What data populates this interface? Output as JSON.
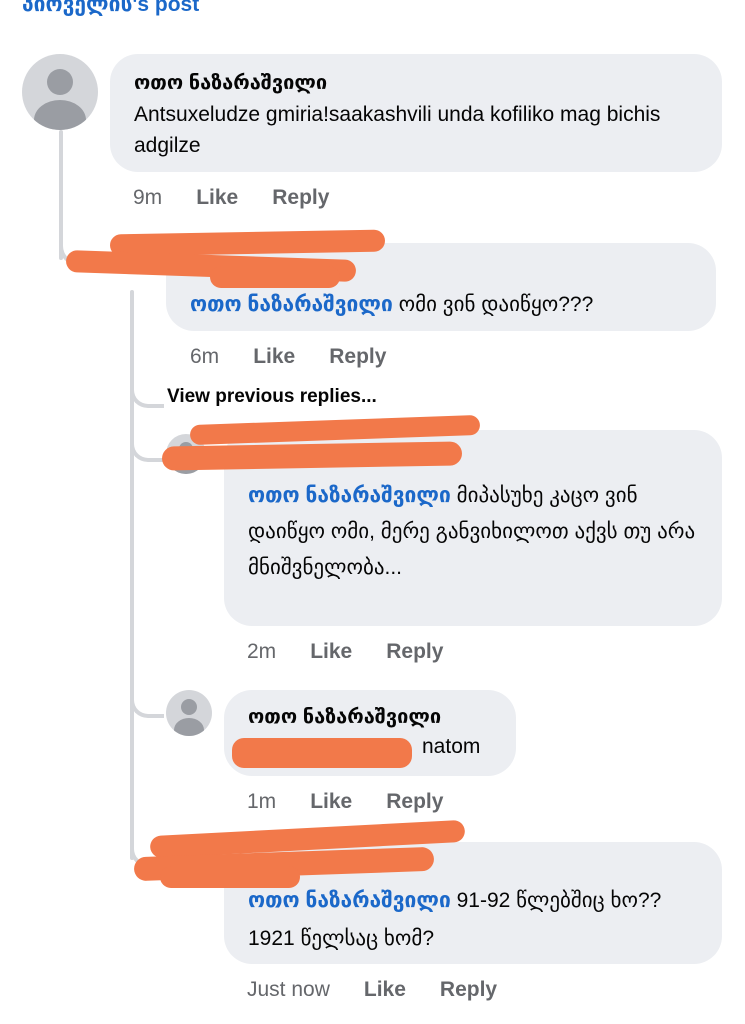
{
  "header": {
    "name_text": " პიოველის",
    "suffix": "'s post"
  },
  "comments": [
    {
      "author": "ოთო ნაზარაშვილი",
      "text": "Antsuxeludze gmiria!saakashvili unda kofiliko mag bichis adgilze",
      "time": "9m",
      "like": "Like",
      "reply": "Reply"
    },
    {
      "mention": "ოთო ნაზარაშვილი",
      "text": "ომი ვინ დაიწყო???",
      "time": "6m",
      "like": "Like",
      "reply": "Reply"
    },
    {
      "mention": "ოთო ნაზარაშვილი",
      "text": "მიპასუხე კაცო ვინ დაიწყო ომი, მერე განვიხილოთ აქვს თუ არა მნიშვნელობა...",
      "time": "2m",
      "like": "Like",
      "reply": "Reply"
    },
    {
      "author": "ოთო ნაზარაშვილი",
      "text": "natom",
      "time": "1m",
      "like": "Like",
      "reply": "Reply"
    },
    {
      "mention": "ოთო ნაზარაშვილი",
      "text": "91-92 წლებშიც ხო?? 1921 წელსაც ხომ?",
      "time": "Just now",
      "like": "Like",
      "reply": "Reply"
    }
  ],
  "view_previous": "View previous replies...",
  "colors": {
    "bubble": "#eceef2",
    "mention": "#1b68c9",
    "meta": "#65676b",
    "redaction": "#f2794a",
    "thread": "#d4d6da"
  }
}
